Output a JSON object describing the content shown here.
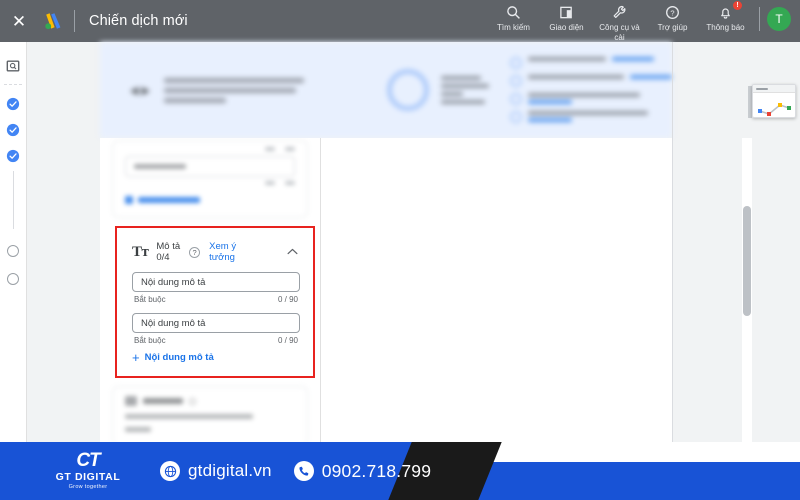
{
  "topbar": {
    "close_icon": "close-icon",
    "logo_icon": "google-ads-logo",
    "title": "Chiến dịch mới",
    "actions": [
      {
        "icon": "search-icon",
        "label": "Tìm kiếm"
      },
      {
        "icon": "layout-icon",
        "label": "Giao diện"
      },
      {
        "icon": "wrench-icon",
        "label": "Công cụ và cài"
      },
      {
        "icon": "help-icon",
        "label": "Trợ giúp"
      },
      {
        "icon": "bell-icon",
        "label": "Thông báo",
        "badge": "!"
      }
    ],
    "avatar_initial": "T"
  },
  "rail": {
    "search_icon": "rail-search-icon",
    "steps": [
      {
        "icon": "check-circle-icon",
        "state": "done"
      },
      {
        "icon": "check-circle-icon",
        "state": "done"
      },
      {
        "icon": "check-circle-icon",
        "state": "done"
      },
      {
        "icon": "circle-icon",
        "state": "pending"
      },
      {
        "icon": "circle-icon",
        "state": "pending"
      }
    ]
  },
  "card": {
    "icon": "text-format-icon",
    "icon_glyph": "Tт",
    "title": "Mô tả",
    "counter": "0/4",
    "help_icon": "help-circle-icon",
    "help_glyph": "?",
    "ideas_link": "Xem ý tưởng",
    "collapse_icon": "chevron-up-icon",
    "collapse_glyph": "⌃",
    "fields": [
      {
        "placeholder": "Nội dung mô tả",
        "value": "",
        "required_label": "Bắt buộc",
        "counter": "0 / 90"
      },
      {
        "placeholder": "Nội dung mô tả",
        "value": "",
        "required_label": "Bắt buộc",
        "counter": "0 / 90"
      }
    ],
    "add_icon": "plus-icon",
    "add_glyph": "+",
    "add_label": "Nội dung mô tả",
    "highlight_color": "#e8231f",
    "accent_color": "#1a73e8"
  },
  "preview": {
    "thumbnail_icon": "chart-preview-thumbnail"
  },
  "scrollbar": {
    "name": "vertical-scrollbar"
  },
  "footer": {
    "brand_mark": "CT",
    "brand_name": "GT DIGITAL",
    "brand_tagline": "Grow together",
    "website_icon": "globe-icon",
    "website": "gtdigital.vn",
    "phone_icon": "phone-icon",
    "phone": "0902.718.799",
    "bg_color": "#1853d6",
    "wedge_color": "#1a1a1a"
  }
}
